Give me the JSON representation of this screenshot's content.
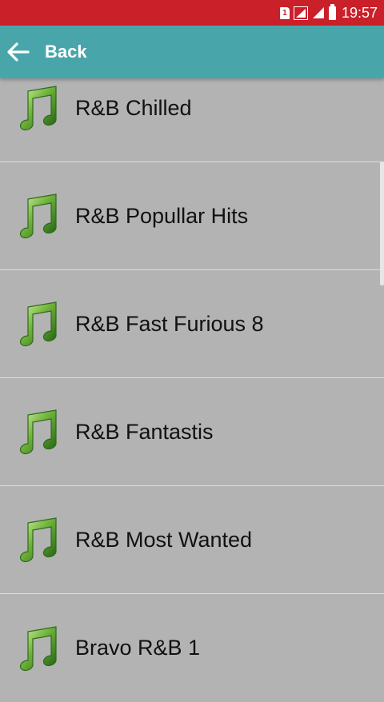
{
  "status_bar": {
    "sim_label": "1",
    "time": "19:57"
  },
  "app_bar": {
    "back_label": "Back"
  },
  "list": {
    "items": [
      {
        "label": "R&B Chilled",
        "icon": "music-note-icon"
      },
      {
        "label": "R&B Popullar Hits",
        "icon": "music-note-icon"
      },
      {
        "label": "R&B Fast Furious 8",
        "icon": "music-note-icon"
      },
      {
        "label": "R&B Fantastis",
        "icon": "music-note-icon"
      },
      {
        "label": "R&B Most Wanted",
        "icon": "music-note-icon"
      },
      {
        "label": "Bravo R&B 1",
        "icon": "music-note-icon"
      }
    ]
  },
  "colors": {
    "status_bar": "#c9202a",
    "app_bar": "#48a6ab",
    "list_background": "#b3b3b3",
    "note_green": "#4a9a2a"
  }
}
